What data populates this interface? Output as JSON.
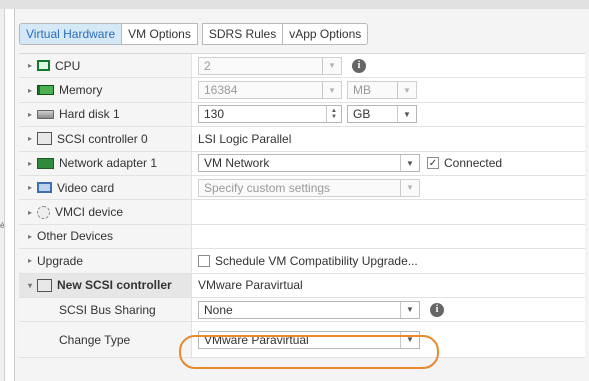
{
  "tabs": [
    {
      "label": "Virtual Hardware",
      "active": true
    },
    {
      "label": "VM Options",
      "active": false
    },
    {
      "label": "SDRS Rules",
      "active": false
    },
    {
      "label": "vApp Options",
      "active": false
    }
  ],
  "side_marker": "é",
  "rows": {
    "cpu": {
      "label": "CPU",
      "value": "2"
    },
    "memory": {
      "label": "Memory",
      "value": "16384",
      "unit": "MB"
    },
    "hard_disk": {
      "label": "Hard disk 1",
      "value": "130",
      "unit": "GB"
    },
    "scsi0": {
      "label": "SCSI controller 0",
      "value": "LSI Logic Parallel"
    },
    "network": {
      "label": "Network adapter 1",
      "value": "VM Network",
      "connected_label": "Connected",
      "connected": true
    },
    "video": {
      "label": "Video card",
      "placeholder": "Specify custom settings"
    },
    "vmci": {
      "label": "VMCI device"
    },
    "other": {
      "label": "Other Devices"
    },
    "upgrade": {
      "label": "Upgrade",
      "checkbox_label": "Schedule VM Compatibility Upgrade..."
    },
    "new_scsi": {
      "label": "New SCSI controller",
      "value": "VMware Paravirtual"
    },
    "bus_sharing": {
      "label": "SCSI Bus Sharing",
      "value": "None"
    },
    "change_type": {
      "label": "Change Type",
      "value": "VMware Paravirtual"
    }
  },
  "icons": {
    "expand": "▸",
    "expanded": "▾",
    "dropdown": "▼",
    "info": "i",
    "check": "✓",
    "spin_up": "▲",
    "spin_down": "▼"
  },
  "colors": {
    "active_tab_bg": "#d5e8f6",
    "highlight": "#e8892b"
  }
}
